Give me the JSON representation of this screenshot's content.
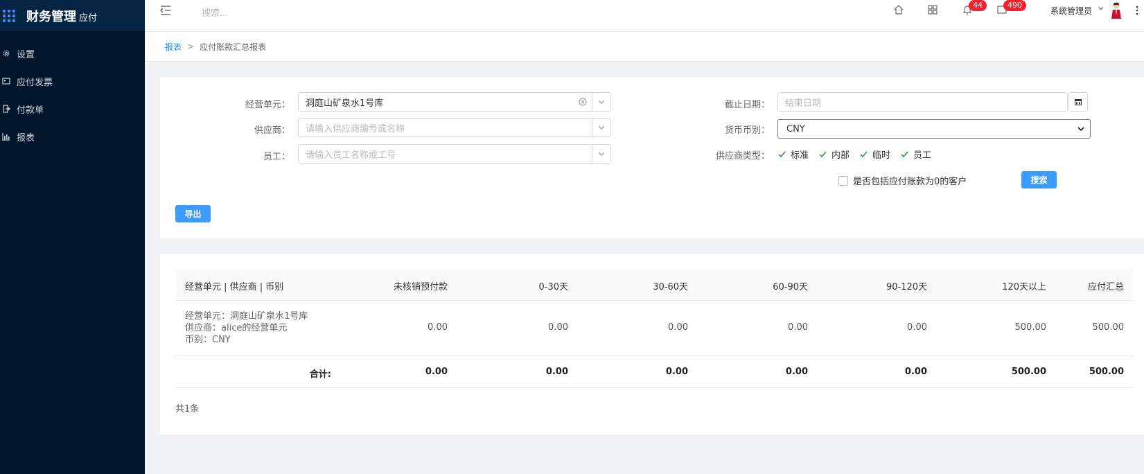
{
  "app": {
    "title": "财务管理",
    "subtitle": "应付"
  },
  "sidebar": {
    "items": [
      {
        "label": "设置",
        "icon": "gear-icon"
      },
      {
        "label": "应付发票",
        "icon": "invoice-icon"
      },
      {
        "label": "付款单",
        "icon": "payment-icon"
      },
      {
        "label": "报表",
        "icon": "bar-chart-icon"
      }
    ]
  },
  "header": {
    "search_placeholder": "搜索...",
    "notifications_count": "44",
    "messages_count": "490",
    "user_name": "系统管理员"
  },
  "breadcrumb": {
    "root": "报表",
    "separator": ">",
    "current": "应付账款汇总报表"
  },
  "filters": {
    "business_unit": {
      "label": "经营单元：",
      "value": "洞庭山矿泉水1号库"
    },
    "supplier": {
      "label": "供应商：",
      "placeholder": "请输入供应商编号或名称"
    },
    "employee": {
      "label": "员工：",
      "placeholder": "请输入员工名称或工号"
    },
    "end_date": {
      "label": "截止日期：",
      "placeholder": "结束日期"
    },
    "currency": {
      "label": "货币币别：",
      "value": "CNY"
    },
    "supplier_type": {
      "label": "供应商类型：",
      "options": [
        {
          "label": "标准",
          "checked": true
        },
        {
          "label": "内部",
          "checked": true
        },
        {
          "label": "临时",
          "checked": true
        },
        {
          "label": "员工",
          "checked": true
        }
      ]
    },
    "include_zero": {
      "label": "是否包括应付账款为0的客户",
      "checked": false
    },
    "search_button": "搜索",
    "export_button": "导出"
  },
  "table": {
    "columns": [
      "经营单元 | 供应商 | 币别",
      "未核销预付款",
      "0-30天",
      "30-60天",
      "60-90天",
      "90-120天",
      "120天以上",
      "应付汇总"
    ],
    "rows": [
      {
        "desc": [
          "经营单元：洞庭山矿泉水1号库",
          "供应商：alice的经营单元",
          "币别：CNY"
        ],
        "values": [
          "0.00",
          "0.00",
          "0.00",
          "0.00",
          "0.00",
          "500.00",
          "500.00"
        ]
      }
    ],
    "total": {
      "label": "合计:",
      "values": [
        "0.00",
        "0.00",
        "0.00",
        "0.00",
        "0.00",
        "500.00",
        "500.00"
      ]
    },
    "count_text": "共1条"
  },
  "colors": {
    "sidebar_bg": "#00152a",
    "brand_bg": "#062443",
    "primary": "#3b9bff",
    "link": "#1890ff",
    "badge": "#f5222d"
  }
}
